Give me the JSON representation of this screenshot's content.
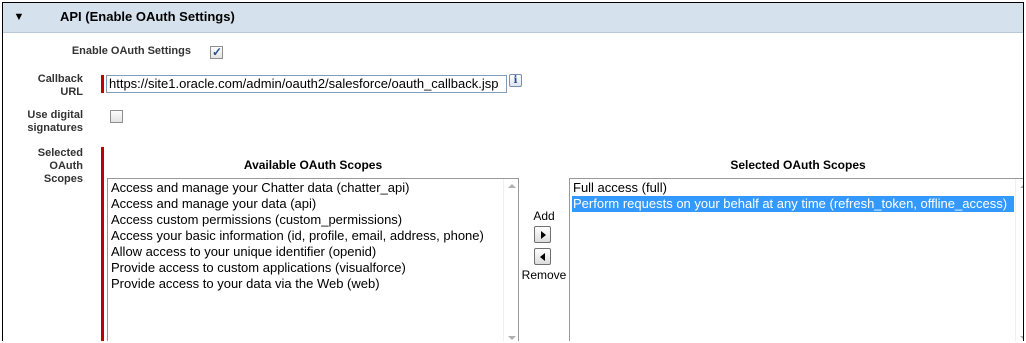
{
  "section": {
    "title": "API (Enable OAuth Settings)",
    "toggle_glyph": "▼"
  },
  "enable_oauth": {
    "label": "Enable OAuth Settings",
    "checked": true
  },
  "callback_url": {
    "label_line1": "Callback",
    "label_line2": "URL",
    "value": "https://site1.oracle.com/admin/oauth2/salesforce/oauth_callback.jsp",
    "info_glyph": "i"
  },
  "digital_signatures": {
    "label_line1": "Use digital",
    "label_line2": "signatures",
    "checked": false
  },
  "oauth_scopes": {
    "label_line1": "Selected",
    "label_line2": "OAuth",
    "label_line3": "Scopes",
    "available_heading": "Available OAuth Scopes",
    "selected_heading": "Selected OAuth Scopes",
    "add_label": "Add",
    "remove_label": "Remove",
    "available": [
      "Access and manage your Chatter data (chatter_api)",
      "Access and manage your data (api)",
      "Access custom permissions (custom_permissions)",
      "Access your basic information (id, profile, email, address, phone)",
      "Allow access to your unique identifier (openid)",
      "Provide access to custom applications (visualforce)",
      "Provide access to your data via the Web (web)"
    ],
    "selected": [
      "Full access (full)",
      "Perform requests on your behalf at any time (refresh_token, offline_access)"
    ],
    "highlighted_selected": "Perform requests on your behalf at any time (refresh_token, offline_access)"
  },
  "colors": {
    "header_bg": "#d6e1ee",
    "required_marker": "#c00000",
    "selection_highlight": "#3399ff"
  }
}
